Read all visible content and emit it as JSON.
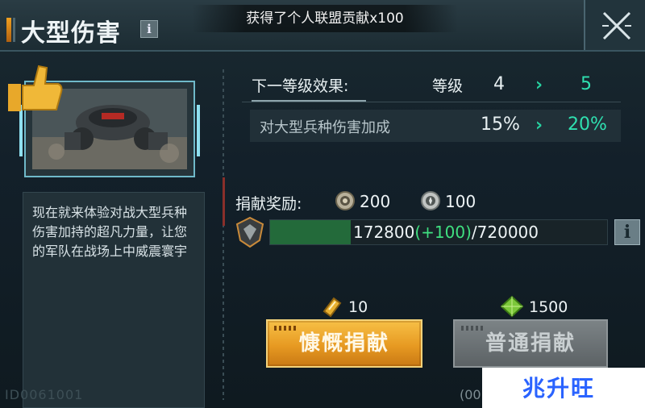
{
  "header": {
    "title": "大型伤害",
    "info_glyph": "i",
    "toast": "获得了个人联盟贡献x100",
    "close_icon": "close-x-icon"
  },
  "upgrade": {
    "next_level_label": "下一等级效果:",
    "level_label": "等级",
    "level_from": "4",
    "level_to": "5",
    "arrow": "›",
    "effect_label": "对大型兵种伤害加成",
    "effect_from": "15%",
    "effect_to": "20%"
  },
  "description": {
    "text": "现在就来体验对战大型兵种伤害加持的超凡力量，让您的军队在战场上中威震寰宇",
    "id_text": "ID0061001"
  },
  "rewards": {
    "label": "捐献奖励:",
    "items": [
      {
        "icon": "alliance-coin-icon",
        "value": "200"
      },
      {
        "icon": "honor-coin-icon",
        "value": "100"
      }
    ]
  },
  "progress": {
    "current": "172800",
    "added": "(+100)",
    "total": "/720000",
    "fraction": 0.24,
    "info_glyph": "i"
  },
  "donate": {
    "generous": {
      "label": "慷慨捐献",
      "cost": "10",
      "cost_icon": "gold-ticket-icon"
    },
    "normal": {
      "label": "普通捐献",
      "cost": "1500",
      "cost_icon": "green-crystal-icon"
    },
    "timer": "(00:"
  },
  "watermark": "兆升旺",
  "colors": {
    "accent_green": "#2fe0b0",
    "button_gold": "#e79a22",
    "progress_green": "#236a3a"
  }
}
